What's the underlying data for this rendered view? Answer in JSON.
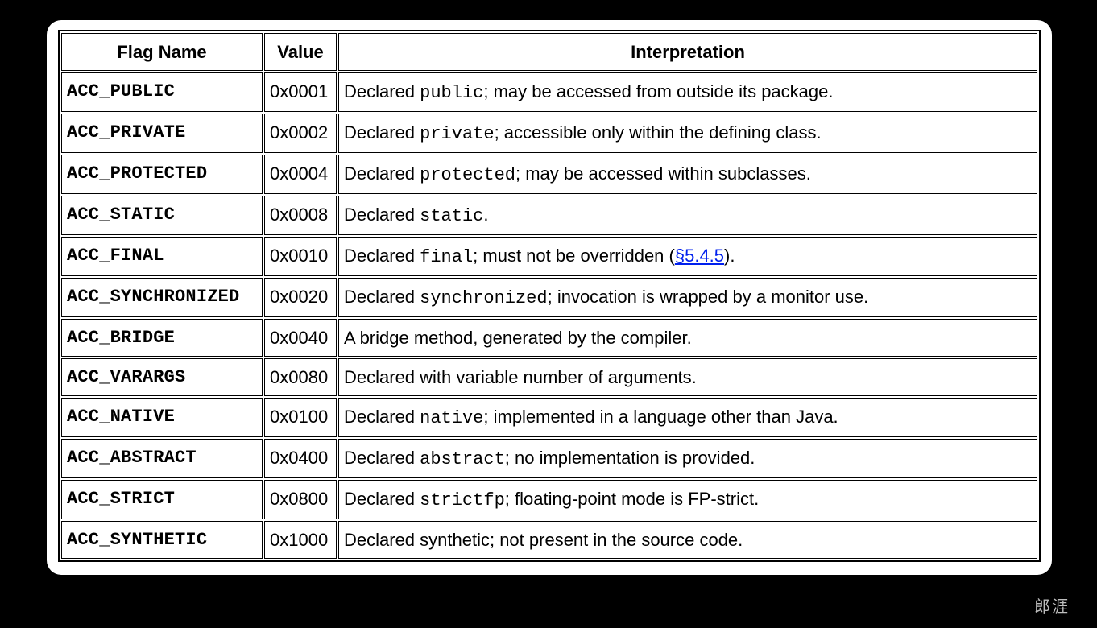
{
  "headers": {
    "flag": "Flag Name",
    "value": "Value",
    "interpretation": "Interpretation"
  },
  "rows": [
    {
      "flag": "ACC_PUBLIC",
      "value": "0x0001",
      "pre": "Declared ",
      "kw": "public",
      "post": "; may be accessed from outside its package."
    },
    {
      "flag": "ACC_PRIVATE",
      "value": "0x0002",
      "pre": "Declared ",
      "kw": "private",
      "post": "; accessible only within the defining class."
    },
    {
      "flag": "ACC_PROTECTED",
      "value": "0x0004",
      "pre": "Declared ",
      "kw": "protected",
      "post": "; may be accessed within subclasses."
    },
    {
      "flag": "ACC_STATIC",
      "value": "0x0008",
      "pre": "Declared ",
      "kw": "static",
      "post": "."
    },
    {
      "flag": "ACC_FINAL",
      "value": "0x0010",
      "pre": "Declared ",
      "kw": "final",
      "post": "; must not be overridden (",
      "link": "§5.4.5",
      "after_link": ")."
    },
    {
      "flag": "ACC_SYNCHRONIZED",
      "value": "0x0020",
      "pre": "Declared ",
      "kw": "synchronized",
      "post": "; invocation is wrapped by a monitor use."
    },
    {
      "flag": "ACC_BRIDGE",
      "value": "0x0040",
      "pre": "A bridge method, generated by the compiler.",
      "kw": "",
      "post": ""
    },
    {
      "flag": "ACC_VARARGS",
      "value": "0x0080",
      "pre": "Declared with variable number of arguments.",
      "kw": "",
      "post": ""
    },
    {
      "flag": "ACC_NATIVE",
      "value": "0x0100",
      "pre": "Declared ",
      "kw": "native",
      "post": "; implemented in a language other than Java."
    },
    {
      "flag": "ACC_ABSTRACT",
      "value": "0x0400",
      "pre": "Declared ",
      "kw": "abstract",
      "post": "; no implementation is provided."
    },
    {
      "flag": "ACC_STRICT",
      "value": "0x0800",
      "pre": "Declared ",
      "kw": "strictfp",
      "post": "; floating-point mode is FP-strict."
    },
    {
      "flag": "ACC_SYNTHETIC",
      "value": "0x1000",
      "pre": "Declared synthetic; not present in the source code.",
      "kw": "",
      "post": ""
    }
  ],
  "watermark": "郎涯"
}
